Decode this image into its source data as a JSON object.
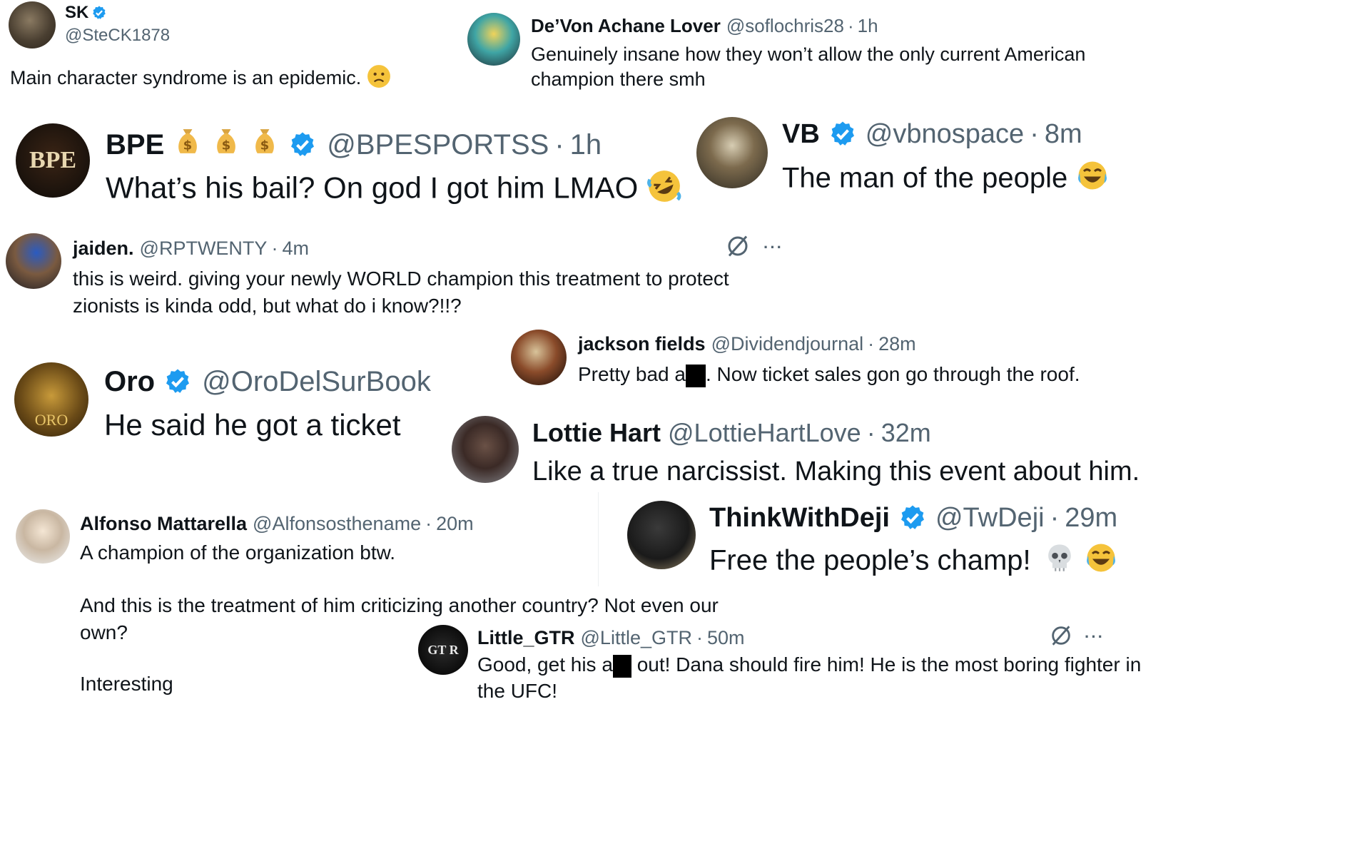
{
  "colors": {
    "verified": "#1d9bf0",
    "handle": "#536471",
    "text": "#0f1419"
  },
  "tweets": [
    {
      "name": "SK",
      "handle": "@SteCK1878",
      "time": "",
      "verified": true,
      "text": "Main character syndrome is an epidemic.",
      "emoji": "slightly-frowning-face"
    },
    {
      "name": "De’Von Achane Lover",
      "handle": "@soflochris28",
      "sep": "·",
      "time": "1h",
      "text_1": "Genuinely insane how they won’t allow the only current American",
      "text_2": "champion there smh"
    },
    {
      "name": "BPE",
      "handle": "@BPESPORTSS",
      "sep": "·",
      "time": "1h",
      "verified": true,
      "avatar_text": "BPE",
      "text": "What’s his bail? On god I got him LMAO",
      "emoji": "rolling-on-floor-laughing"
    },
    {
      "name": "VB",
      "handle": "@vbnospace",
      "sep": "·",
      "time": "8m",
      "verified": true,
      "text": "The man of the people",
      "emoji": "face-with-tears-of-joy"
    },
    {
      "name": "jaiden.",
      "handle": "@RPTWENTY",
      "sep": "·",
      "time": "4m",
      "text_1": "this is weird. giving your newly WORLD champion this treatment to protect",
      "text_2": "zionists is kinda odd, but what do i know?!!?"
    },
    {
      "name": "jackson fields",
      "handle": "@Dividendjournal",
      "sep": "·",
      "time": "28m",
      "text_a": "Pretty bad a",
      "text_b": ". Now ticket sales gon go through the roof."
    },
    {
      "name": "Oro",
      "handle": "@OroDelSurBook",
      "verified": true,
      "avatar_text": "ORO",
      "text": "He said he got a ticket"
    },
    {
      "name": "Lottie Hart",
      "handle": "@LottieHartLove",
      "sep": "·",
      "time": "32m",
      "text": "Like a true narcissist. Making this event about him."
    },
    {
      "name": "Alfonso Mattarella",
      "handle": "@Alfonsosthename",
      "sep": "·",
      "time": "20m",
      "text_1": "A champion of the organization btw.",
      "text_2": "And this is the treatment of him criticizing another country? Not even our",
      "text_3": "own?",
      "text_4": "Interesting"
    },
    {
      "name": "ThinkWithDeji",
      "handle": "@TwDeji",
      "sep": "·",
      "time": "29m",
      "verified": true,
      "text": "Free the people’s champ!",
      "emoji_1": "skull",
      "emoji_2": "face-with-tears-of-joy"
    },
    {
      "name": "Little_GTR",
      "handle": "@Little_GTR",
      "sep": "·",
      "time": "50m",
      "avatar_text": "GT R",
      "text_a": "Good, get his a",
      "text_b": "out! Dana should fire him! He is the most boring fighter in",
      "text_c": "the UFC!"
    }
  ],
  "more_label": "···"
}
